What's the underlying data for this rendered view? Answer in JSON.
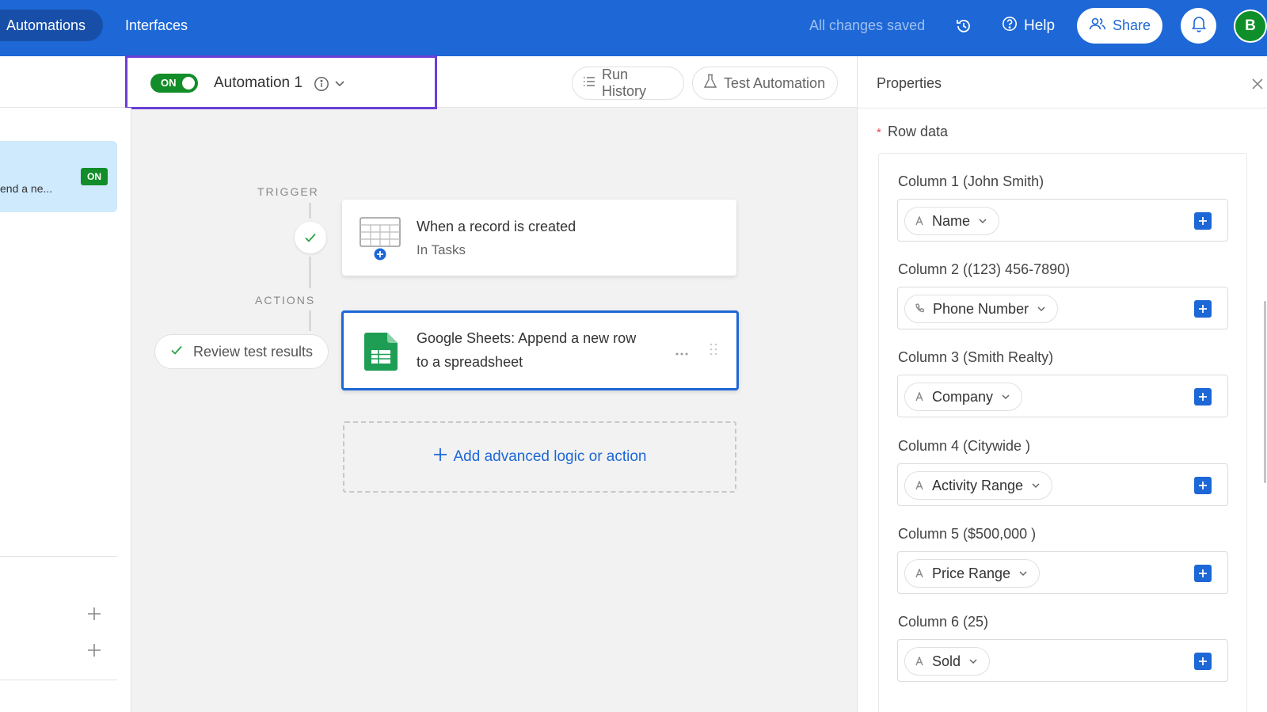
{
  "topbar": {
    "tabs": [
      {
        "label": "Automations",
        "active": true
      },
      {
        "label": "Interfaces",
        "active": false
      }
    ],
    "saved_status": "All changes saved",
    "history_icon": "history-icon",
    "help_label": "Help",
    "share_label": "Share",
    "bell_icon": "bell-icon",
    "avatar_initial": "B",
    "accent_color": "#1d67d6"
  },
  "subheader": {
    "toggle_label": "ON",
    "automation_name": "Automation 1",
    "run_history_label": "Run History",
    "test_automation_label": "Test Automation"
  },
  "sidebar": {
    "card_text": "end a ne...",
    "card_badge": "ON"
  },
  "flow": {
    "trigger_label": "TRIGGER",
    "actions_label": "ACTIONS",
    "trigger": {
      "title": "When a record is created",
      "subtitle": "In Tasks"
    },
    "action": {
      "title_line1": "Google Sheets: Append a new row",
      "title_line2": "to a spreadsheet"
    },
    "review_label": "Review test results",
    "add_logic_label": "Add advanced logic or action"
  },
  "properties": {
    "title": "Properties",
    "required_mark": "*",
    "section_label": "Row data",
    "columns": [
      {
        "label": "Column 1 (John Smith)",
        "field": "Name",
        "icon": "text-field-icon"
      },
      {
        "label": "Column 2 ((123) 456-7890)",
        "field": "Phone Number",
        "icon": "phone-icon"
      },
      {
        "label": "Column 3 (Smith Realty)",
        "field": "Company",
        "icon": "text-field-icon"
      },
      {
        "label": "Column 4 (Citywide )",
        "field": "Activity Range",
        "icon": "text-field-icon"
      },
      {
        "label": "Column 5 ($500,000 )",
        "field": "Price Range",
        "icon": "text-field-icon"
      },
      {
        "label": "Column 6 (25)",
        "field": "Sold",
        "icon": "text-field-icon"
      }
    ]
  }
}
